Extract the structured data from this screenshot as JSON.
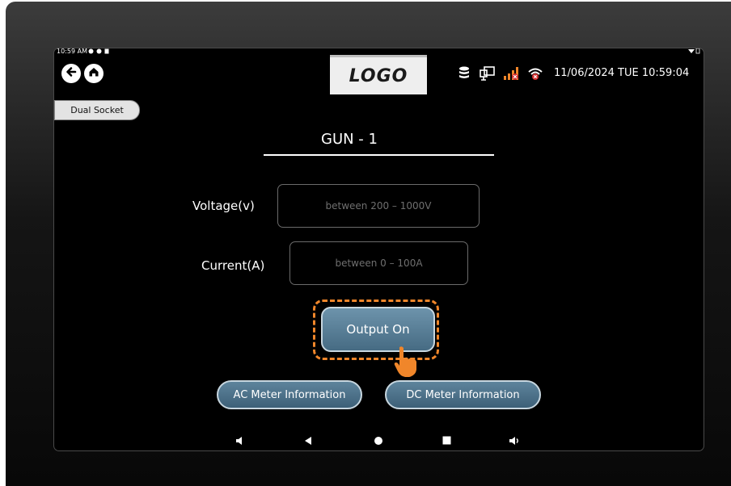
{
  "statusbar": {
    "time": "10:59 AM"
  },
  "header": {
    "back_icon": "arrow-left-circle",
    "home_icon": "home-circle",
    "logo_text": "LOGO",
    "datetime": "11/06/2024 TUE 10:59:04",
    "icons": [
      "database-icon",
      "network-icon",
      "signal-off-icon",
      "wifi-off-icon"
    ]
  },
  "socket_mode": "Dual Socket",
  "gun_title": "GUN - 1",
  "voltage": {
    "label": "Voltage(v)",
    "placeholder": "between 200 – 1000V",
    "value": ""
  },
  "current": {
    "label": "Current(A)",
    "placeholder": "between 0 – 100A",
    "value": ""
  },
  "buttons": {
    "output": "Output On",
    "ac_meter": "AC Meter Information",
    "dc_meter": "DC Meter Information"
  },
  "colors": {
    "highlight": "#f0862a",
    "button_fill": "#5a7f97"
  }
}
